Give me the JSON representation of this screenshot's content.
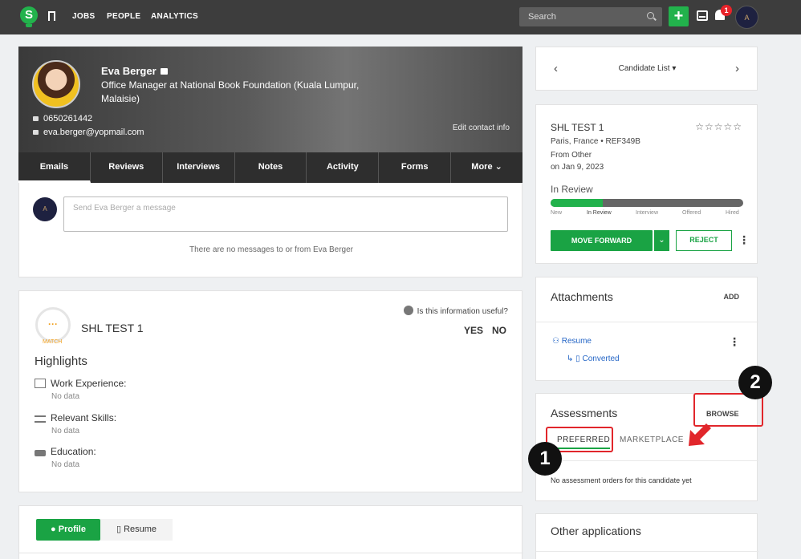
{
  "nav": {
    "logo": "S",
    "links": [
      "JOBS",
      "PEOPLE",
      "ANALYTICS"
    ],
    "search_placeholder": "Search",
    "plus": "+",
    "notif_count": "1",
    "avatar": "A"
  },
  "candidate": {
    "name": "Eva Berger",
    "title": "Office Manager at National Book Foundation (Kuala Lumpur, Malaisie)",
    "phone": "0650261442",
    "email": "eva.berger@yopmail.com",
    "edit_contact": "Edit contact info",
    "tabs": [
      "Emails",
      "Reviews",
      "Interviews",
      "Notes",
      "Activity",
      "Forms",
      "More"
    ]
  },
  "messages": {
    "avatar": "A",
    "placeholder": "Send Eva Berger a message",
    "empty": "There are no messages to or from Eva Berger"
  },
  "match": {
    "ring": "···",
    "ring_label": "MATCH",
    "job": "SHL TEST 1",
    "useful_q": "Is this information useful?",
    "yes": "YES",
    "no": "NO",
    "highlights": "Highlights",
    "sections": [
      {
        "label": "Work Experience:",
        "value": "No data"
      },
      {
        "label": "Relevant Skills:",
        "value": "No data"
      },
      {
        "label": "Education:",
        "value": "No data"
      }
    ]
  },
  "bottom_tabs": {
    "profile": "Profile",
    "resume": "Resume"
  },
  "candidate_list": {
    "label": "Candidate List ▾",
    "prev": "‹",
    "next": "›"
  },
  "job": {
    "title": "SHL TEST 1",
    "stars": "☆☆☆☆☆",
    "location": "Paris, France  •  REF349B",
    "source": "From Other",
    "date": "on Jan 9, 2023",
    "status": "In Review",
    "progress_fraction": 0.27,
    "stages": [
      "New",
      "In Review",
      "Interview",
      "Offered",
      "Hired"
    ],
    "move_forward": "MOVE FORWARD",
    "dropdown": "⌄",
    "reject": "REJECT"
  },
  "attachments": {
    "title": "Attachments",
    "add": "ADD",
    "resume": "Resume",
    "converted": "Converted"
  },
  "assessments": {
    "title": "Assessments",
    "browse": "BROWSE",
    "tab_preferred": "PREFERRED",
    "tab_marketplace": "MARKETPLACE",
    "empty": "No assessment orders for this candidate yet"
  },
  "other_apps": {
    "title": "Other applications"
  },
  "annotations": {
    "one": "1",
    "two": "2"
  },
  "colors": {
    "accent_green": "#1aa344",
    "link_blue": "#2566c6",
    "annotation_red": "#e1262b"
  }
}
